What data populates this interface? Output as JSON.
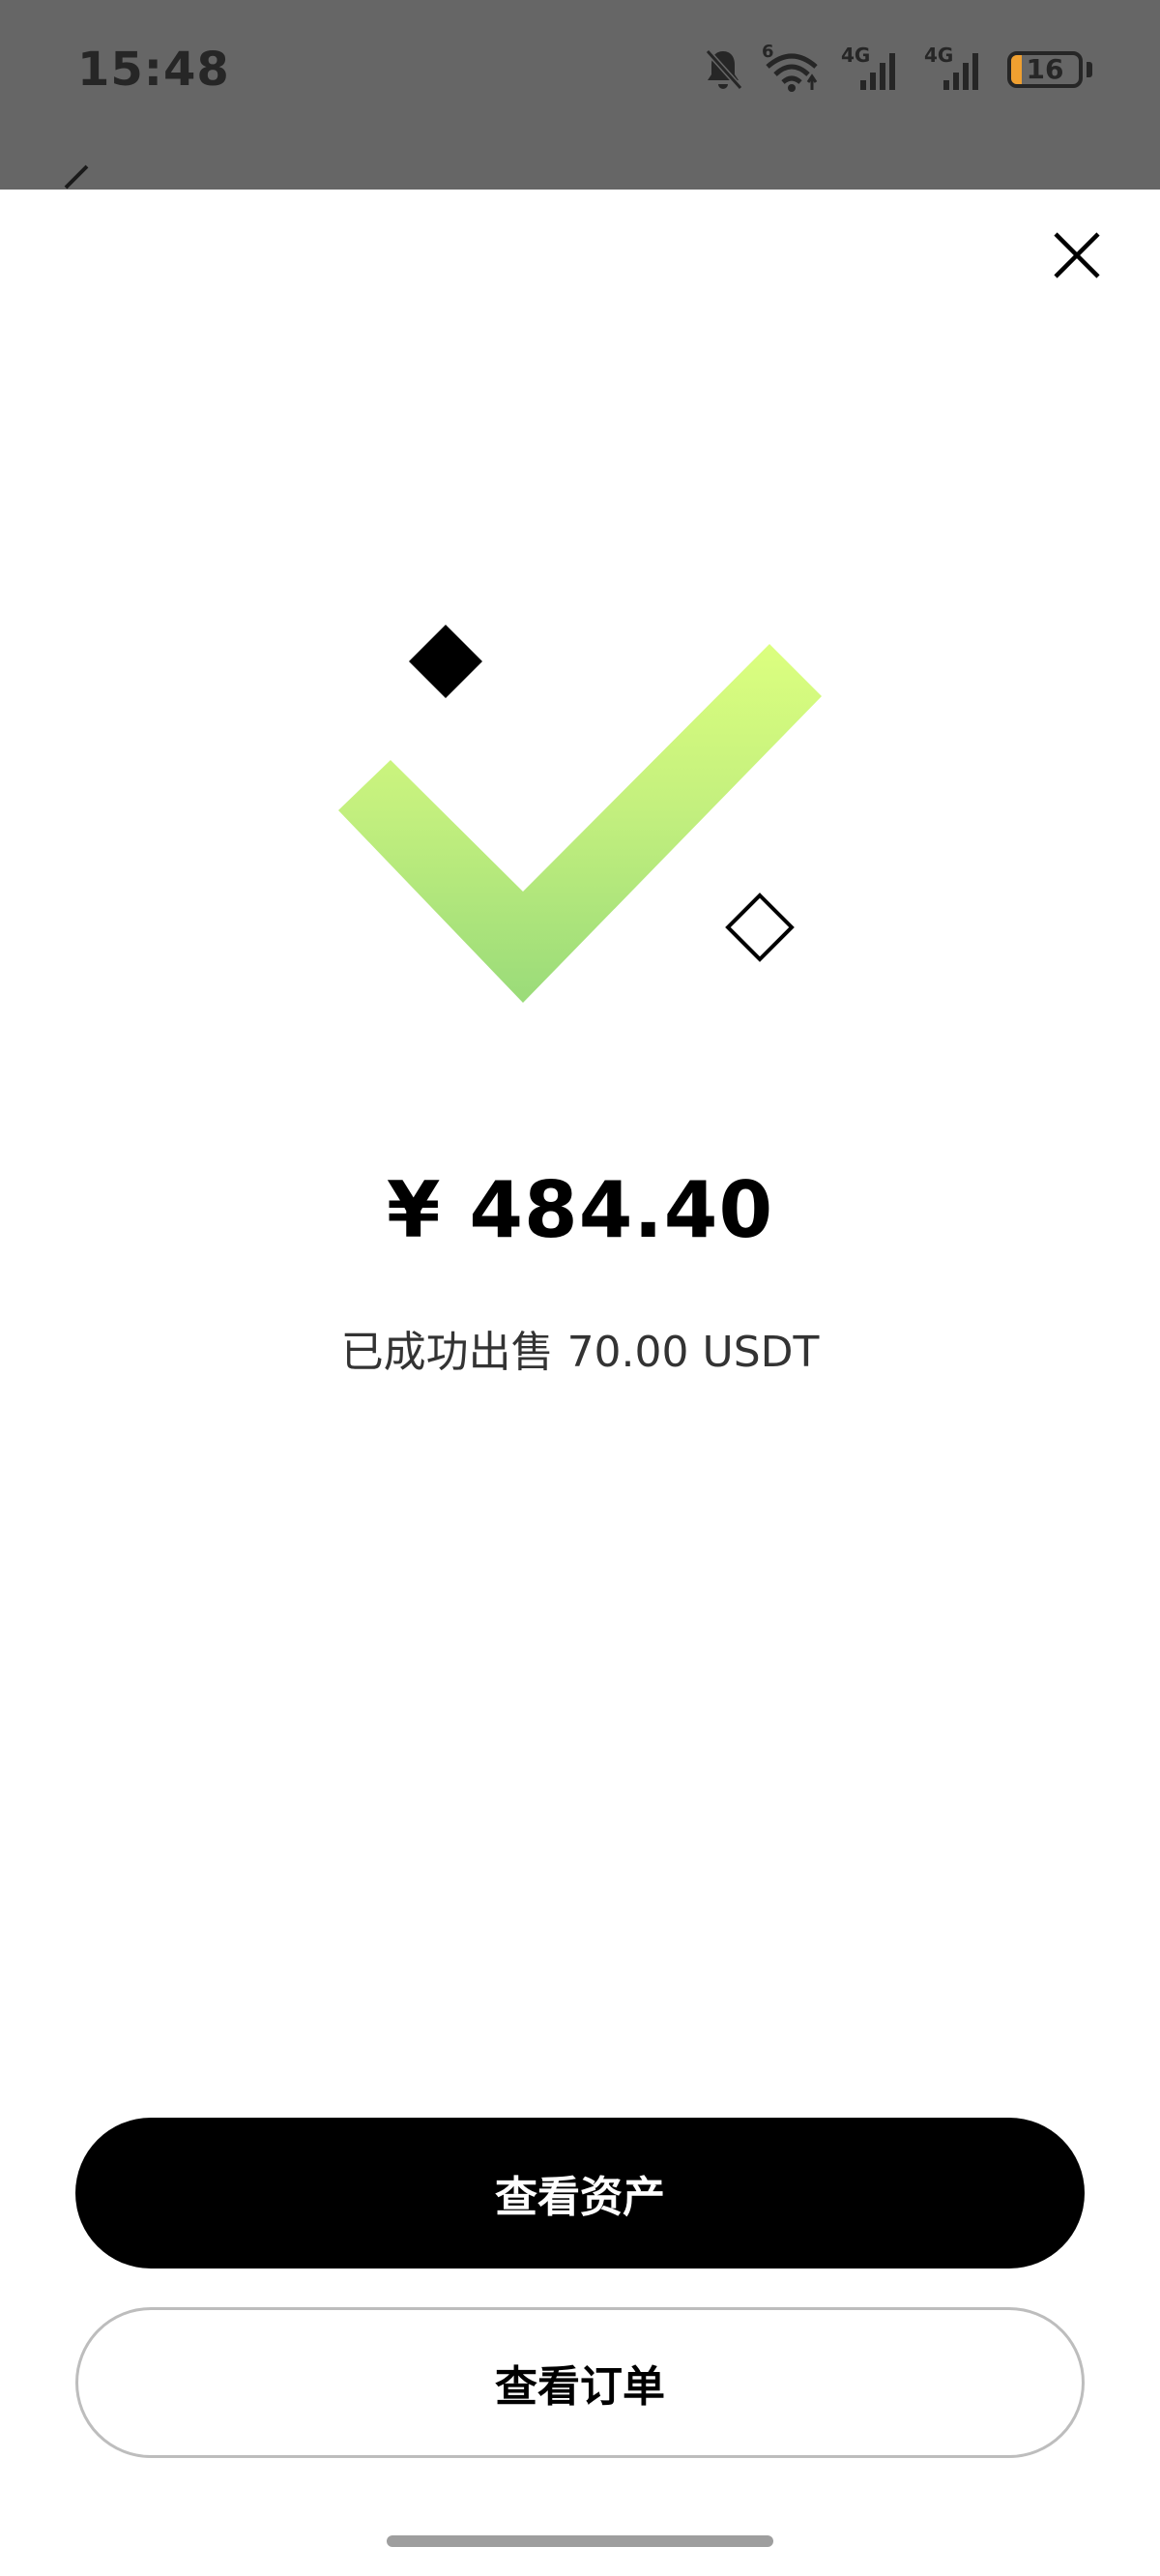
{
  "status_bar": {
    "time": "15:48",
    "battery_level": "16",
    "network_label_1": "4G",
    "network_label_2": "4G",
    "wifi_label": "6",
    "icons": [
      "mute-bell-icon",
      "wifi-icon",
      "signal-4g-icon",
      "signal-4g-icon",
      "battery-icon"
    ]
  },
  "result": {
    "amount": "¥ 484.40",
    "message": "已成功出售 70.00 USDT",
    "icon": "success-check-icon"
  },
  "actions": {
    "primary_label": "查看资产",
    "secondary_label": "查看订单"
  },
  "close_icon": "close-icon",
  "colors": {
    "primary_button": "#000000",
    "check_gradient_top": "#DCFF7F",
    "check_gradient_bottom": "#9ADB79",
    "status_bar_overlay": "#666666",
    "battery_fill": "#F0A030"
  }
}
